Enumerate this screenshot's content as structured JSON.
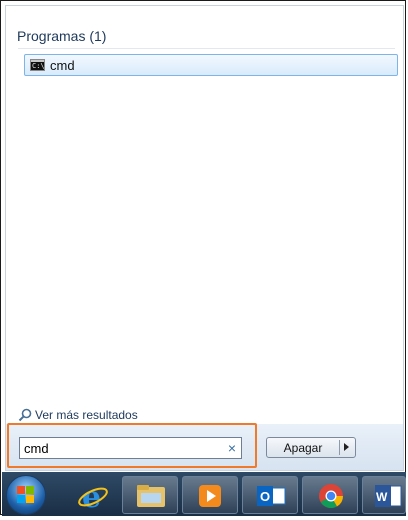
{
  "start_menu": {
    "section_title": "Programas (1)",
    "results": [
      {
        "label": "cmd",
        "icon": "cmd-icon"
      }
    ],
    "more_results": "Ver más resultados"
  },
  "search": {
    "value": "cmd",
    "clear_icon": "×"
  },
  "shutdown": {
    "label": "Apagar"
  },
  "taskbar": {
    "items": [
      {
        "name": "start-orb",
        "icon": "windows-logo-icon"
      },
      {
        "name": "internet-explorer",
        "icon": "internet-explorer-icon"
      },
      {
        "name": "file-explorer",
        "icon": "folder-icon"
      },
      {
        "name": "media-player",
        "icon": "media-player-icon"
      },
      {
        "name": "outlook",
        "icon": "outlook-icon"
      },
      {
        "name": "chrome",
        "icon": "chrome-icon"
      },
      {
        "name": "word",
        "icon": "word-icon"
      }
    ]
  },
  "colors": {
    "highlight": "#f07a2a",
    "selection_border": "#7eb4ea",
    "title_text": "#1e395b",
    "taskbar": "#1f3650"
  }
}
